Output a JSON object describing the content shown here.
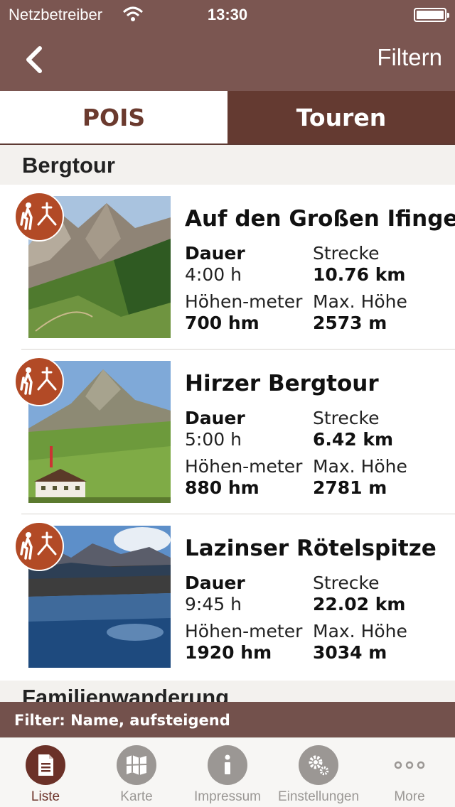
{
  "status_bar": {
    "carrier": "Netzbetreiber",
    "time": "13:30"
  },
  "nav": {
    "filter_label": "Filtern"
  },
  "segments": {
    "pois": "POIS",
    "touren": "Touren",
    "active": "Touren"
  },
  "section": {
    "title": "Bergtour"
  },
  "tours": [
    {
      "title": "Auf den Großen Ifinger",
      "dauer_label": "Dauer",
      "dauer": "4:00 h",
      "strecke_label": "Strecke",
      "strecke": "10.76 km",
      "hoehenmeter_label": "Höhen-meter",
      "hoehenmeter": "700 hm",
      "maxhoehe_label": "Max. Höhe",
      "maxhoehe": "2573 m"
    },
    {
      "title": "Hirzer Bergtour",
      "dauer_label": "Dauer",
      "dauer": "5:00 h",
      "strecke_label": "Strecke",
      "strecke": "6.42 km",
      "hoehenmeter_label": "Höhen-meter",
      "hoehenmeter": "880 hm",
      "maxhoehe_label": "Max. Höhe",
      "maxhoehe": "2781 m"
    },
    {
      "title": "Lazinser Rötelspitze",
      "dauer_label": "Dauer",
      "dauer": "9:45 h",
      "strecke_label": "Strecke",
      "strecke": "22.02 km",
      "hoehenmeter_label": "Höhen-meter",
      "hoehenmeter": "1920 hm",
      "maxhoehe_label": "Max. Höhe",
      "maxhoehe": "3034 m"
    }
  ],
  "next_section": {
    "title": "Familienwanderung"
  },
  "filter_banner": "Filter: Name, aufsteigend",
  "tabbar": [
    {
      "label": "Liste",
      "icon": "list-icon",
      "active": true
    },
    {
      "label": "Karte",
      "icon": "map-icon",
      "active": false
    },
    {
      "label": "Impressum",
      "icon": "info-icon",
      "active": false
    },
    {
      "label": "Einstellungen",
      "icon": "gear-icon",
      "active": false
    },
    {
      "label": "More",
      "icon": "more-icon",
      "active": false
    }
  ],
  "colors": {
    "header": "#7b5651",
    "active_tab": "#643a31",
    "badge": "#b24a26",
    "accent": "#6b3128"
  }
}
